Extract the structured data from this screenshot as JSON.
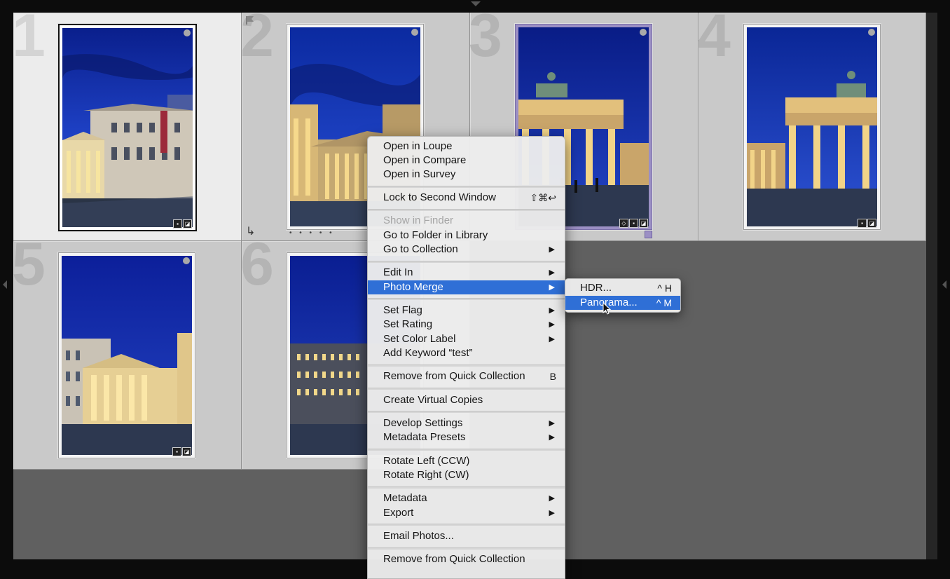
{
  "grid": {
    "cells": [
      {
        "number": "1",
        "selected": true
      },
      {
        "number": "2",
        "selected": false
      },
      {
        "number": "3",
        "selected": false
      },
      {
        "number": "4",
        "selected": false
      },
      {
        "number": "5",
        "selected": false
      },
      {
        "number": "6",
        "selected": false
      }
    ],
    "cell2_dots": "• • • • •"
  },
  "context_menu": {
    "items": [
      {
        "label": "Open in Loupe"
      },
      {
        "label": "Open in Compare"
      },
      {
        "label": "Open in Survey"
      },
      {
        "label": "Lock to Second Window",
        "shortcut": "⇧⌘↩"
      },
      {
        "label": "Show in Finder",
        "disabled": true
      },
      {
        "label": "Go to Folder in Library"
      },
      {
        "label": "Go to Collection",
        "submenu": true
      },
      {
        "label": "Edit In",
        "submenu": true
      },
      {
        "label": "Photo Merge",
        "submenu": true,
        "highlighted": true
      },
      {
        "label": "Set Flag",
        "submenu": true
      },
      {
        "label": "Set Rating",
        "submenu": true
      },
      {
        "label": "Set Color Label",
        "submenu": true
      },
      {
        "label": "Add Keyword “test”"
      },
      {
        "label": "Remove from Quick Collection",
        "shortcut": "B"
      },
      {
        "label": "Create Virtual Copies"
      },
      {
        "label": "Develop Settings",
        "submenu": true
      },
      {
        "label": "Metadata Presets",
        "submenu": true
      },
      {
        "label": "Rotate Left (CCW)"
      },
      {
        "label": "Rotate Right (CW)"
      },
      {
        "label": "Metadata",
        "submenu": true
      },
      {
        "label": "Export",
        "submenu": true
      },
      {
        "label": "Email Photos..."
      },
      {
        "label": "Remove from Quick Collection"
      }
    ],
    "submenu_arrow": "▶"
  },
  "photo_merge_submenu": {
    "items": [
      {
        "label": "HDR...",
        "shortcut": "^ H"
      },
      {
        "label": "Panorama...",
        "shortcut": "^ M",
        "highlighted": true
      }
    ]
  },
  "colors": {
    "accent": "#2f6fd6",
    "cell_bg": "#c9c9c9",
    "cell_selected_bg": "#ececec",
    "grid_bg": "#606060",
    "color_label_purple": "#9b8fc4"
  }
}
